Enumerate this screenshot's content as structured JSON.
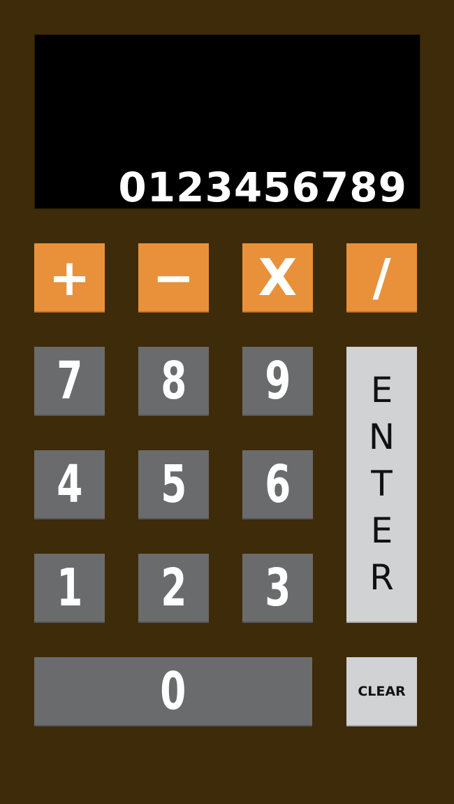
{
  "display": {
    "value": "0123456789"
  },
  "operators": {
    "add": "+",
    "subtract": "−",
    "multiply": "X",
    "divide": "/"
  },
  "digits": {
    "seven": "7",
    "eight": "8",
    "nine": "9",
    "four": "4",
    "five": "5",
    "six": "6",
    "one": "1",
    "two": "2",
    "three": "3",
    "zero": "0"
  },
  "enter": {
    "letters": [
      "E",
      "N",
      "T",
      "E",
      "R"
    ]
  },
  "clear": {
    "label": "CLEAR"
  },
  "colors": {
    "body": "#3d2b09",
    "display": "#000000",
    "operator": "#e8913a",
    "digit": "#6a6b6d",
    "function": "#d1d2d4"
  }
}
